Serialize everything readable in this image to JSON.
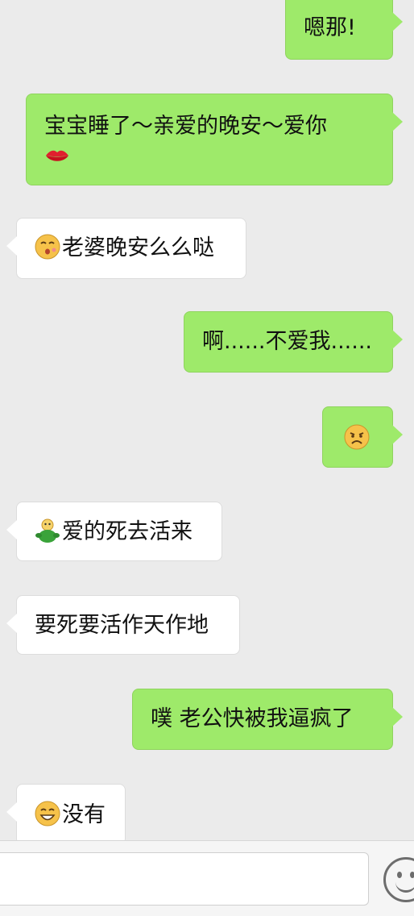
{
  "messages": [
    {
      "side": "out",
      "text": "嗯那!"
    },
    {
      "side": "out",
      "text": "宝宝睡了～亲爱的晚安～爱你",
      "emoji_after": "lips-icon"
    },
    {
      "side": "in",
      "emoji_before": "blowing-kiss-face-icon",
      "text": "老婆晚安么么哒"
    },
    {
      "side": "out",
      "text": "啊......不爱我......"
    },
    {
      "side": "out",
      "emoji_only": "sad-face-icon"
    },
    {
      "side": "in",
      "emoji_before": "hugging-figure-icon",
      "text": "爱的死去活来"
    },
    {
      "side": "in",
      "text": "要死要活作天作地"
    },
    {
      "side": "out",
      "text": "噗 老公快被我逼疯了"
    },
    {
      "side": "in",
      "emoji_before": "grinning-face-icon",
      "text": "没有"
    }
  ],
  "input_bar": {
    "value": "",
    "placeholder": "",
    "emoji_button_icon": "smiley-face-icon"
  },
  "colors": {
    "background": "#ebebeb",
    "outgoing_bubble": "#9eea6a",
    "incoming_bubble": "#ffffff",
    "emoji_face": "#f6c24a"
  }
}
